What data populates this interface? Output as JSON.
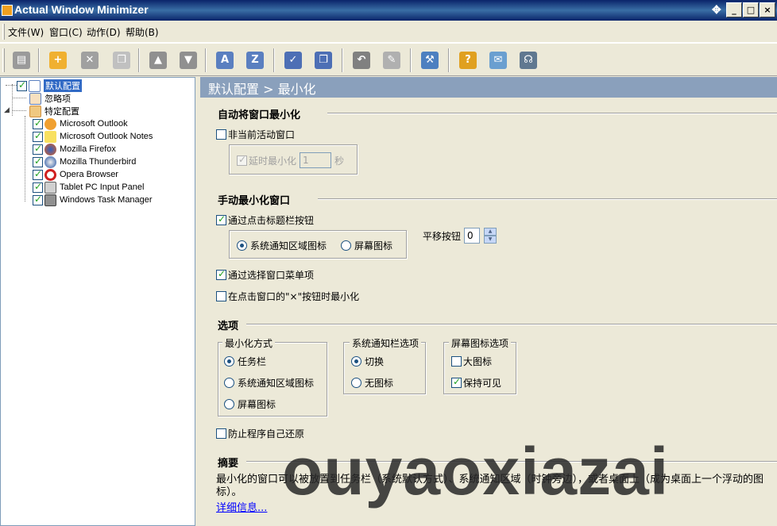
{
  "window": {
    "title": "Actual Window Minimizer"
  },
  "menubar": {
    "items": [
      "文件(W)",
      "窗口(C)",
      "动作(D)",
      "帮助(B)"
    ]
  },
  "toolbar": {
    "icons": [
      "save-icon",
      "new-folder-icon",
      "delete-icon",
      "copy-icon",
      "move-up-icon",
      "move-down-icon",
      "sort-az-icon",
      "sort-za-icon",
      "check-all-icon",
      "windows-icon",
      "undo-icon",
      "paste-icon",
      "tools-icon",
      "help-icon",
      "mail-icon",
      "support-icon"
    ]
  },
  "tree": {
    "items": [
      {
        "label": "默认配置",
        "checked": true,
        "selected": true
      },
      {
        "label": "忽略项",
        "checked": false
      },
      {
        "label": "特定配置",
        "checked": false
      }
    ],
    "apps": [
      {
        "label": "Microsoft Outlook",
        "checked": true,
        "icon": "outlook-icon"
      },
      {
        "label": "Microsoft Outlook Notes",
        "checked": true,
        "icon": "notes-icon"
      },
      {
        "label": "Mozilla Firefox",
        "checked": true,
        "icon": "firefox-icon"
      },
      {
        "label": "Mozilla Thunderbird",
        "checked": true,
        "icon": "thunderbird-icon"
      },
      {
        "label": "Opera Browser",
        "checked": true,
        "icon": "opera-icon"
      },
      {
        "label": "Tablet PC Input Panel",
        "checked": true,
        "icon": "keyboard-icon"
      },
      {
        "label": "Windows Task Manager",
        "checked": true,
        "icon": "taskmanager-icon"
      }
    ]
  },
  "content": {
    "header": "默认配置 > 最小化",
    "auto": {
      "title": "自动将窗口最小化",
      "inactive_label": "非当前活动窗口",
      "inactive_checked": false,
      "delay_label": "延时最小化",
      "delay_value": "1",
      "delay_unit": "秒"
    },
    "manual": {
      "title": "手动最小化窗口",
      "titlebar_label": "通过点击标题栏按钮",
      "titlebar_checked": true,
      "tray_label": "系统通知区域图标",
      "screen_label": "屏幕图标",
      "offset_label": "平移按钮",
      "offset_value": "0",
      "menu_label": "通过选择窗口菜单项",
      "menu_checked": true,
      "close_label": "在点击窗口的\"×\"按钮时最小化",
      "close_checked": false
    },
    "options": {
      "title": "选项",
      "method_title": "最小化方式",
      "method_items": [
        "任务栏",
        "系统通知区域图标",
        "屏幕图标"
      ],
      "method_selected": 0,
      "tray_title": "系统通知栏选项",
      "tray_items": [
        "切换",
        "无图标"
      ],
      "tray_selected": 0,
      "screen_title": "屏幕图标选项",
      "screen_items": [
        "大图标",
        "保持可见"
      ],
      "screen_checked": [
        false,
        true
      ],
      "prevent_label": "防止程序自己还原",
      "prevent_checked": false
    },
    "summary": {
      "title": "摘要",
      "text": "最小化的窗口可以被放置到任务栏（系统默认方式）、系统通知区域（时钟旁边），或者桌面上（成为桌面上一个浮动的图标）。",
      "link": "详细信息..."
    }
  },
  "watermark": "ouyaoxiazai"
}
